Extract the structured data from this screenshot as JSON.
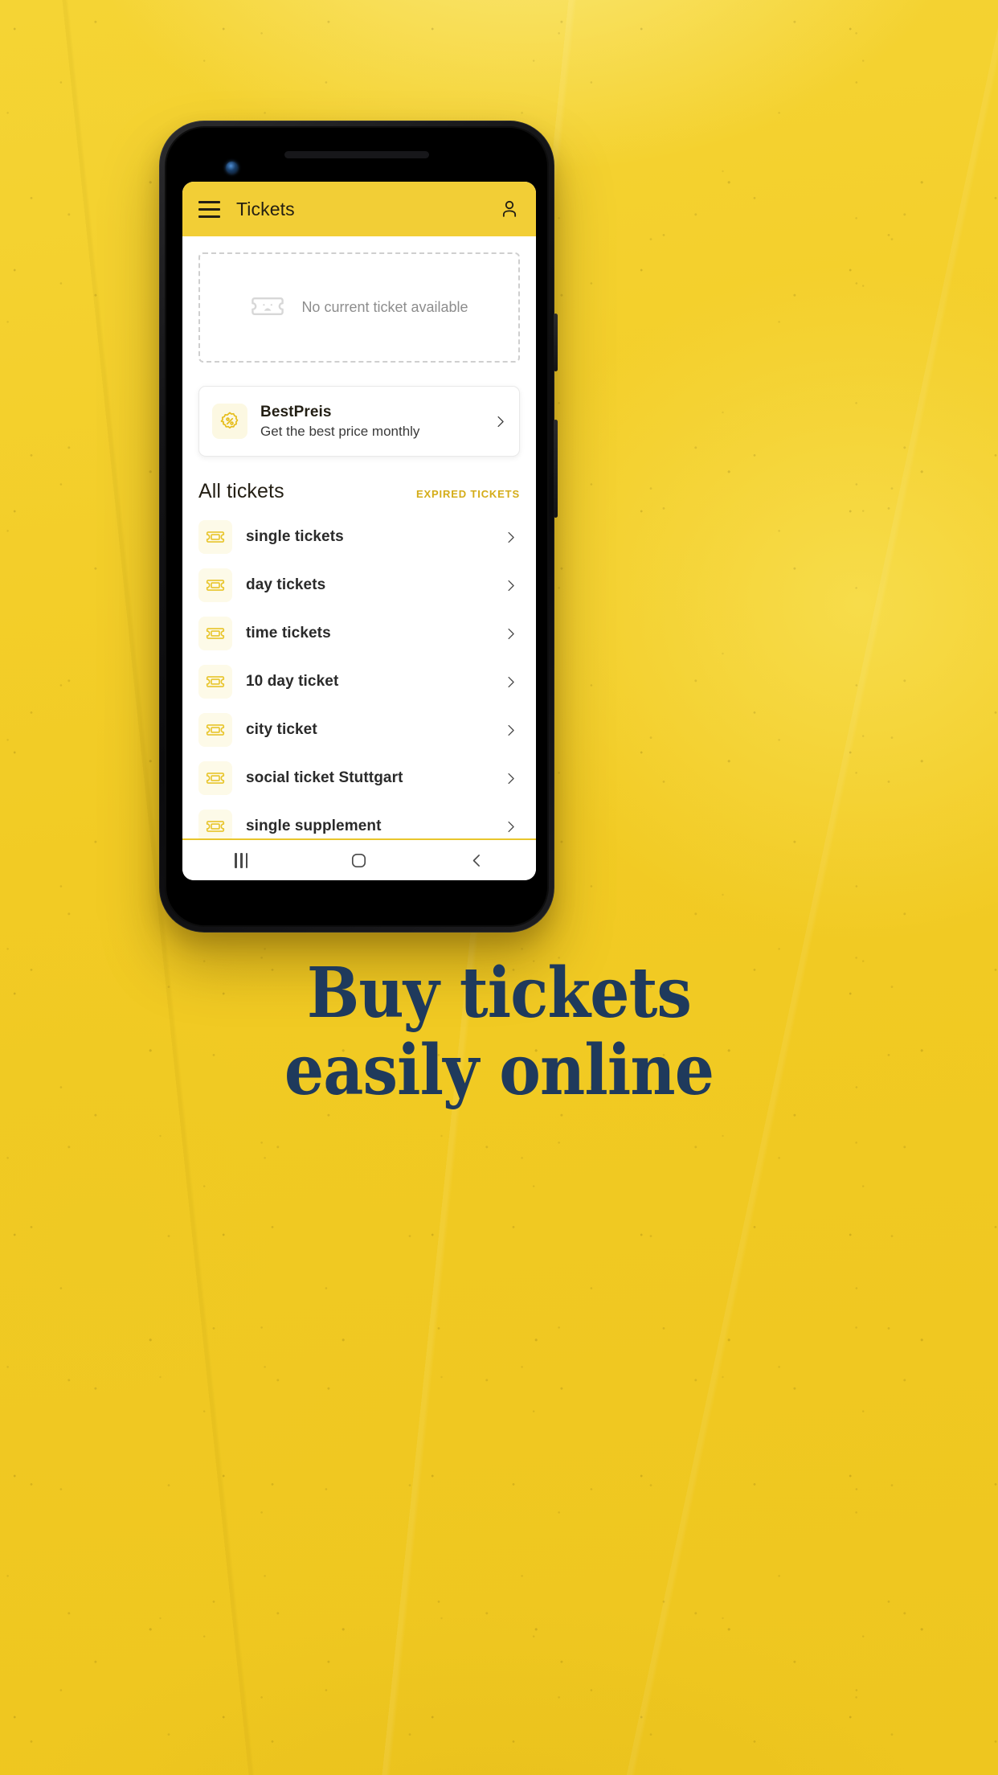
{
  "poster": {
    "headline_line1": "Buy tickets",
    "headline_line2": "easily online",
    "background_color": "#F2CE2A",
    "headline_color": "#1F3A5C"
  },
  "phone": {
    "camera_icon": "front-camera-icon",
    "earpiece_icon": "earpiece-speaker-icon"
  },
  "app": {
    "app_bar": {
      "menu_icon": "hamburger-menu-icon",
      "title": "Tickets",
      "account_icon": "person-icon",
      "background_color": "#F2CE36"
    },
    "empty_ticket": {
      "icon": "sad-ticket-icon",
      "text": "No current ticket available"
    },
    "bestpreis_card": {
      "icon": "percent-badge-icon",
      "title": "BestPreis",
      "subtitle": "Get the best price monthly",
      "chevron_icon": "chevron-right-icon"
    },
    "all_tickets": {
      "title": "All tickets",
      "expired_link": "EXPIRED TICKETS",
      "expired_link_color": "#D4AC18",
      "items": [
        {
          "icon": "ticket-icon",
          "label": "single tickets",
          "chevron_icon": "chevron-right-icon"
        },
        {
          "icon": "ticket-icon",
          "label": "day tickets",
          "chevron_icon": "chevron-right-icon"
        },
        {
          "icon": "ticket-icon",
          "label": "time tickets",
          "chevron_icon": "chevron-right-icon"
        },
        {
          "icon": "ticket-icon",
          "label": "10 day ticket",
          "chevron_icon": "chevron-right-icon"
        },
        {
          "icon": "ticket-icon",
          "label": "city ticket",
          "chevron_icon": "chevron-right-icon"
        },
        {
          "icon": "ticket-icon",
          "label": "social ticket Stuttgart",
          "chevron_icon": "chevron-right-icon"
        },
        {
          "icon": "ticket-icon",
          "label": "single supplement",
          "chevron_icon": "chevron-right-icon"
        }
      ]
    },
    "nav_bar": {
      "recents_icon": "recents-icon",
      "home_icon": "home-icon",
      "back_icon": "back-icon",
      "accent_color": "#E8C52C"
    }
  }
}
